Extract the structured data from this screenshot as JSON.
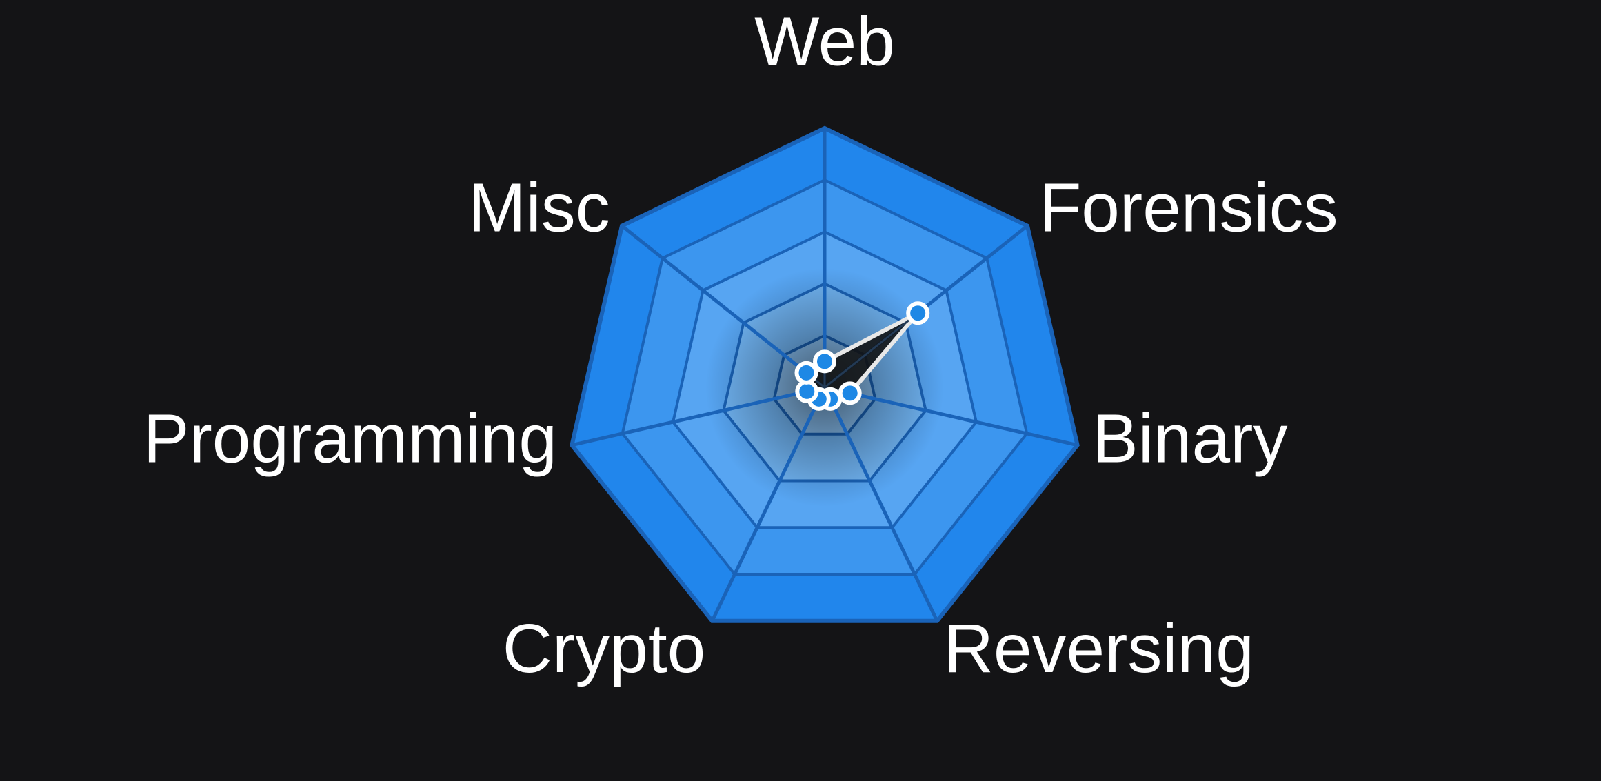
{
  "chart_data": {
    "type": "radar",
    "categories": [
      "Web",
      "Forensics",
      "Binary",
      "Reversing",
      "Crypto",
      "Programming",
      "Misc"
    ],
    "series": [
      {
        "values": [
          10,
          46,
          10,
          5,
          5,
          7,
          9
        ]
      }
    ],
    "rlim": [
      0,
      100
    ],
    "rings": 5,
    "grid": true,
    "legend": "none"
  },
  "colors": {
    "background": "#141416",
    "band_outer": "#2186ec",
    "band_inner": "#8cc4f7",
    "grid_line": "#1a63b8",
    "area_fill": "#111111",
    "area_stroke": "#e8e8e8",
    "point_fill": "#1e88e5",
    "point_stroke": "#ffffff",
    "label": "#ffffff"
  }
}
